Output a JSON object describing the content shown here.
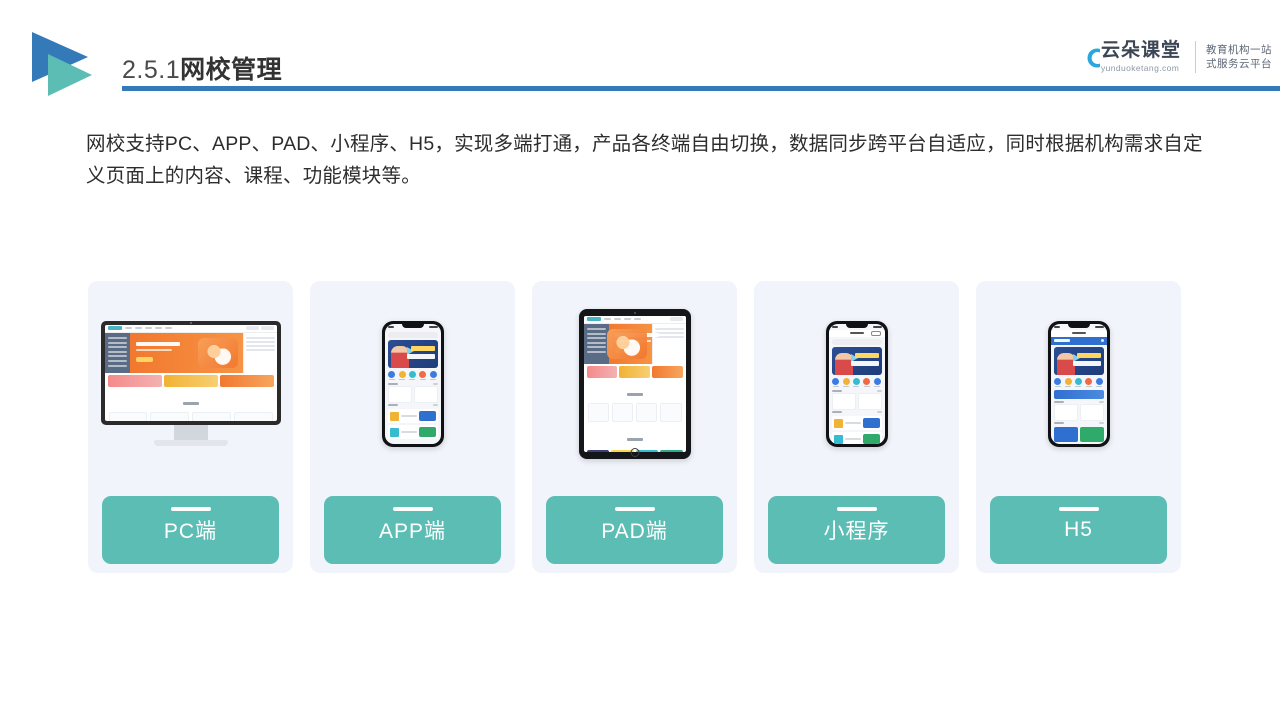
{
  "header": {
    "title_number": "2.5.1",
    "title_text": "网校管理",
    "rule_color": "#3479b8",
    "logo_blue": "#3479b8",
    "logo_teal": "#5cbdb4"
  },
  "brand": {
    "name_cn": "云朵课堂",
    "url": "yunduoketang.com",
    "tagline_line1": "教育机构一站",
    "tagline_line2": "式服务云平台",
    "cloud_color": "#29a8e0"
  },
  "body": {
    "paragraph": "网校支持PC、APP、PAD、小程序、H5，实现多端打通，产品各终端自由切换，数据同步跨平台自适应，同时根据机构需求自定义页面上的内容、课程、功能模块等。"
  },
  "cards": {
    "accent_color": "#5cbdb4",
    "surface_color": "#f2f4fb",
    "items": [
      {
        "label": "PC端",
        "device": "desktop"
      },
      {
        "label": "APP端",
        "device": "phone"
      },
      {
        "label": "PAD端",
        "device": "tablet"
      },
      {
        "label": "小程序",
        "device": "phone"
      },
      {
        "label": "H5",
        "device": "phone"
      }
    ]
  }
}
